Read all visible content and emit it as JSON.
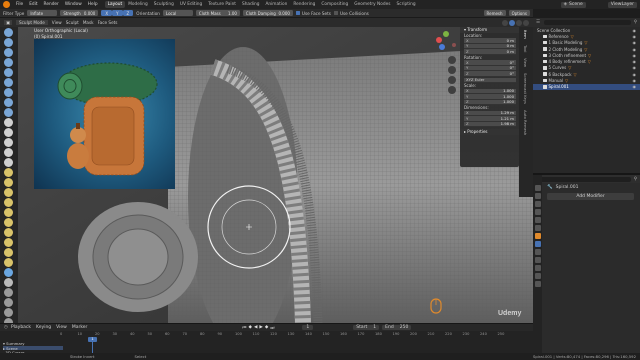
{
  "topbar": {
    "menus": [
      "File",
      "Edit",
      "Render",
      "Window",
      "Help"
    ],
    "workspaces": [
      "Layout",
      "Modeling",
      "Sculpting",
      "UV Editing",
      "Texture Paint",
      "Shading",
      "Animation",
      "Rendering",
      "Compositing",
      "Geometry Nodes",
      "Scripting"
    ],
    "active_workspace": "Layout",
    "scene_label": "Scene",
    "view_layer_label": "ViewLayer"
  },
  "tool_header": {
    "filter_type_label": "Filter Type",
    "filter_type_value": "Inflate",
    "strength_label": "Strength",
    "strength_value": "0.000",
    "orientation_label": "Orientation",
    "orientation_value": "Local",
    "cloth_mass_label": "Cloth Mass",
    "cloth_mass_value": "1.00",
    "cloth_damping_label": "Cloth Damping",
    "cloth_damping_value": "0.000",
    "use_face_sets_label": "Use Face Sets",
    "use_collisions_label": "Use Collisions",
    "remesh_label": "Remesh",
    "options_label": "Options"
  },
  "viewport_header": {
    "mode": "Sculpt Mode",
    "items": [
      "View",
      "Sculpt",
      "Mask",
      "Face Sets"
    ]
  },
  "viewport": {
    "overlay_title": "User Orthographic (Local)",
    "overlay_object": "(0) Spiral.001"
  },
  "npanel": {
    "transform_header": "Transform",
    "location_label": "Location:",
    "location": [
      [
        "X",
        "0 m"
      ],
      [
        "Y",
        "0 m"
      ],
      [
        "Z",
        "0 m"
      ]
    ],
    "rotation_label": "Rotation:",
    "rotation": [
      [
        "X",
        "0°"
      ],
      [
        "Y",
        "0°"
      ],
      [
        "Z",
        "0°"
      ]
    ],
    "rotation_mode": "XYZ Euler",
    "scale_label": "Scale:",
    "scale": [
      [
        "X",
        "1.000"
      ],
      [
        "Y",
        "1.000"
      ],
      [
        "Z",
        "1.000"
      ]
    ],
    "dimensions_label": "Dimensions:",
    "dimensions": [
      [
        "X",
        "1.29 m"
      ],
      [
        "Y",
        "1.21 m"
      ],
      [
        "Z",
        "1.98 m"
      ]
    ],
    "properties_header": "Properties",
    "tabs": [
      "Item",
      "Tool",
      "View",
      "Screencast Keys",
      "Auto Remesh"
    ]
  },
  "outliner": {
    "search_placeholder": "",
    "rows": [
      {
        "label": "Scene Collection",
        "selected": false,
        "indent": 0
      },
      {
        "label": "Reference",
        "selected": false,
        "indent": 1
      },
      {
        "label": "1 Basic Modeling",
        "selected": false,
        "indent": 1
      },
      {
        "label": "2 Cloth Modeling",
        "selected": false,
        "indent": 1
      },
      {
        "label": "3 Cloth refinement",
        "selected": false,
        "indent": 1
      },
      {
        "label": "4 Body refinement",
        "selected": false,
        "indent": 1
      },
      {
        "label": "5 Curves",
        "selected": false,
        "indent": 1
      },
      {
        "label": "6 Backpack",
        "selected": false,
        "indent": 1
      },
      {
        "label": "Manual",
        "selected": false,
        "indent": 1
      },
      {
        "label": "Spiral.001",
        "selected": true,
        "indent": 1
      }
    ]
  },
  "properties": {
    "object_name": "Spiral.001",
    "add_modifier_label": "Add Modifier"
  },
  "timeline": {
    "menus": [
      "Playback",
      "Keying",
      "View",
      "Marker"
    ],
    "current_frame": "1",
    "start_label": "Start",
    "start_value": "1",
    "end_label": "End",
    "end_value": "250",
    "ticks": [
      "0",
      "10",
      "20",
      "30",
      "40",
      "50",
      "60",
      "70",
      "80",
      "90",
      "100",
      "110",
      "120",
      "130",
      "140",
      "150",
      "160",
      "170",
      "180",
      "190",
      "200",
      "210",
      "220",
      "230",
      "240",
      "250"
    ],
    "tracks": [
      "Summary",
      "Scene",
      "3D Cursor"
    ]
  },
  "statusbar": {
    "left": "Stroke Invert",
    "middle": "Select",
    "right": "Spiral.001 | Verts:80,474 | Faces:80,296 | Tris:160,592"
  },
  "watermark": "Udemy",
  "colors": {
    "accent_blue": "#4772b3",
    "selection": "#334d80",
    "collection_orange": "#e08a2c"
  }
}
